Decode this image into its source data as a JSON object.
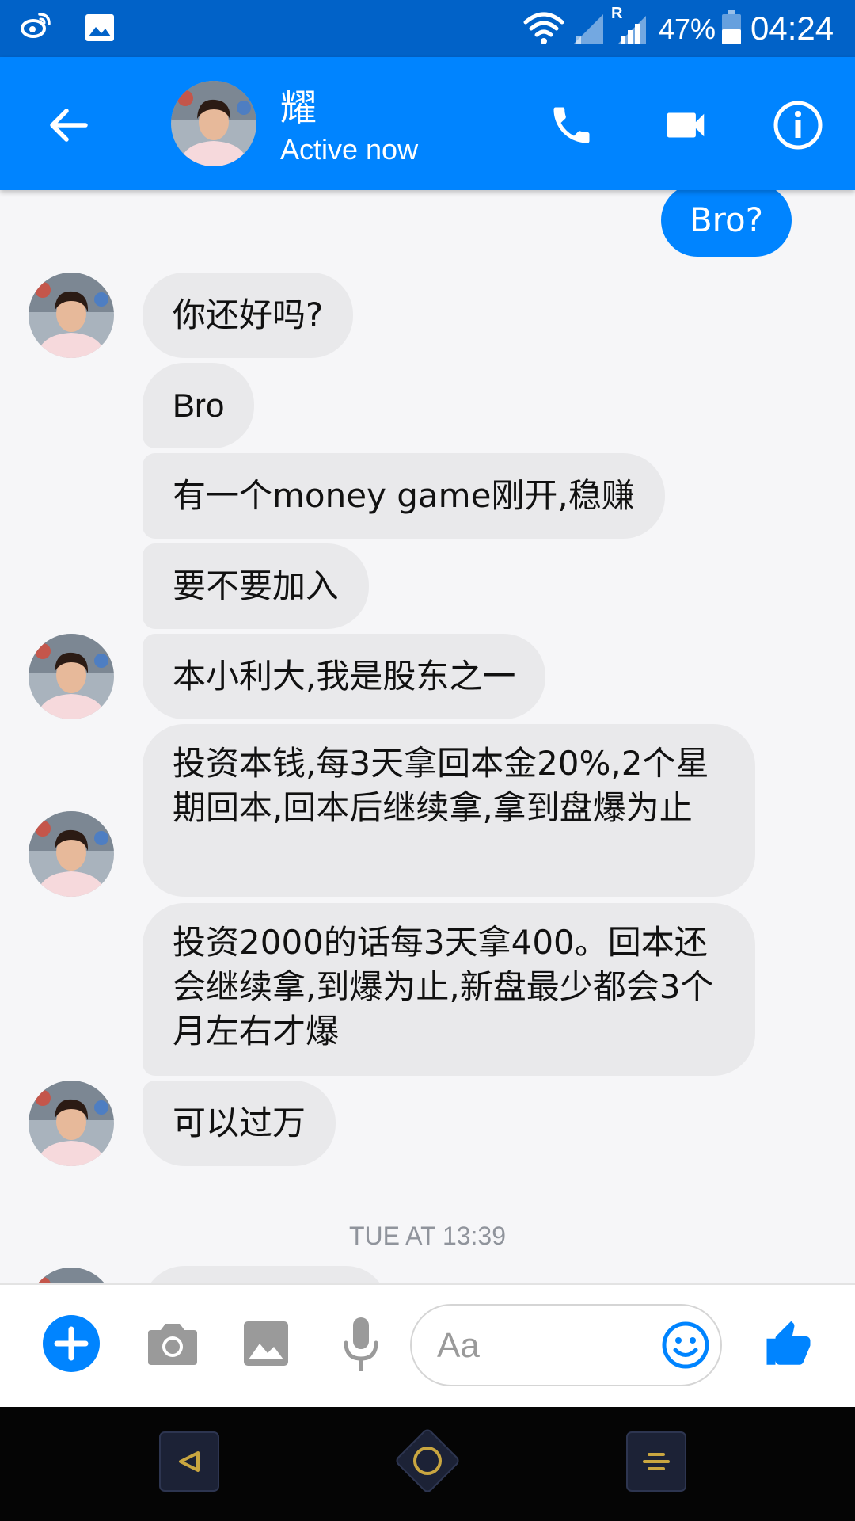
{
  "status_bar": {
    "battery": "47%",
    "time": "04:24",
    "roaming_label": "R",
    "icons": [
      "weibo-icon",
      "gallery-icon",
      "wifi-icon",
      "signal-icon",
      "signal-roaming-icon",
      "battery-icon"
    ]
  },
  "header": {
    "contact_name": "耀",
    "contact_status": "Active now",
    "icons": [
      "back-arrow-icon",
      "phone-icon",
      "video-camera-icon",
      "info-icon"
    ]
  },
  "conversation": {
    "sent": [
      {
        "text": "Bro?"
      }
    ],
    "received": [
      {
        "text": "你还好吗?"
      },
      {
        "text": "Bro"
      },
      {
        "text": "有一个money game刚开,稳赚"
      },
      {
        "text": "要不要加入"
      },
      {
        "text": "本小利大,我是股东之一"
      },
      {
        "text": "投资本钱,每3天拿回本金20%,2个星期回本,回本后继续拿,拿到盘爆为止"
      },
      {
        "text": "投资2000的话每3天拿400。回本还会继续拿,到爆为止,新盘最少都会3个月左右才爆"
      },
      {
        "text": "可以过万"
      }
    ],
    "timestamp": "TUE AT 13:39"
  },
  "composer": {
    "placeholder": "Aa",
    "icons": [
      "plus-icon",
      "camera-icon",
      "image-icon",
      "microphone-icon",
      "emoji-icon",
      "thumbs-up-icon"
    ]
  },
  "colors": {
    "status_bar": "#0162c8",
    "header": "#0084ff",
    "accent": "#0084ff",
    "received_bubble": "#e9e9eb",
    "nav_bar": "#050505",
    "nav_accent": "#c9a640"
  }
}
